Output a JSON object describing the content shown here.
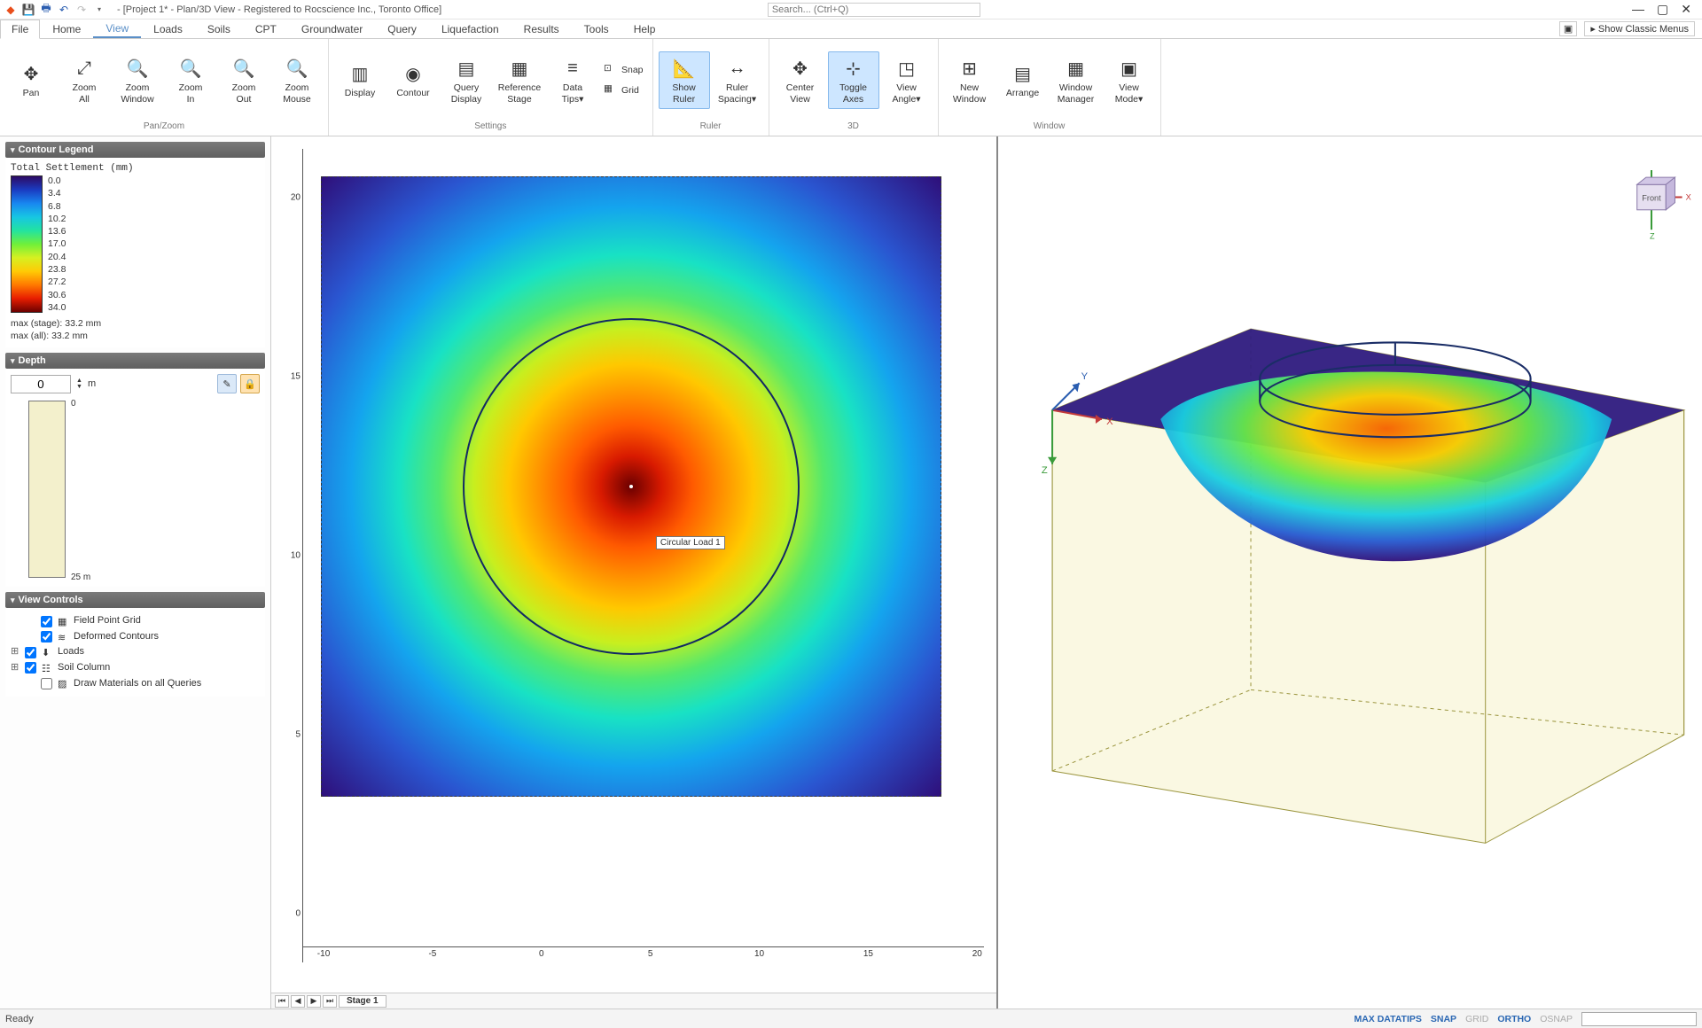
{
  "titlebar": {
    "title": "- [Project 1* - Plan/3D View - Registered to Rocscience Inc., Toronto Office]",
    "search_placeholder": "Search... (Ctrl+Q)"
  },
  "tabs": {
    "items": [
      "File",
      "Home",
      "View",
      "Loads",
      "Soils",
      "CPT",
      "Groundwater",
      "Query",
      "Liquefaction",
      "Results",
      "Tools",
      "Help"
    ],
    "active": "View",
    "classic_menus": "Show Classic Menus"
  },
  "ribbon": {
    "panzoom": {
      "label": "Pan/Zoom",
      "pan": "Pan",
      "zoom_all": "Zoom\nAll",
      "zoom_window": "Zoom\nWindow",
      "zoom_in": "Zoom\nIn",
      "zoom_out": "Zoom\nOut",
      "zoom_mouse": "Zoom\nMouse"
    },
    "settings": {
      "label": "Settings",
      "display": "Display",
      "contour": "Contour",
      "query_display": "Query\nDisplay",
      "reference_stage": "Reference\nStage",
      "data_tips": "Data\nTips▾",
      "snap": "Snap",
      "grid": "Grid"
    },
    "ruler": {
      "label": "Ruler",
      "show_ruler": "Show\nRuler",
      "ruler_spacing": "Ruler\nSpacing▾"
    },
    "threeD": {
      "label": "3D",
      "center_view": "Center\nView",
      "toggle_axes": "Toggle\nAxes",
      "view_angle": "View\nAngle▾"
    },
    "window": {
      "label": "Window",
      "new_window": "New\nWindow",
      "arrange": "Arrange",
      "window_manager": "Window\nManager",
      "view_mode": "View\nMode▾"
    }
  },
  "contour_legend": {
    "heading": "Contour Legend",
    "title": "Total Settlement (mm)",
    "values": [
      "0.0",
      "3.4",
      "6.8",
      "10.2",
      "13.6",
      "17.0",
      "20.4",
      "23.8",
      "27.2",
      "30.6",
      "34.0"
    ],
    "max_stage": "max (stage): 33.2 mm",
    "max_all": "max (all):   33.2 mm"
  },
  "depth": {
    "heading": "Depth",
    "value": "0",
    "unit": "m",
    "top_label": "0",
    "bottom_label": "25 m"
  },
  "view_controls": {
    "heading": "View Controls",
    "items": [
      {
        "label": "Field Point Grid",
        "checked": true,
        "expand": ""
      },
      {
        "label": "Deformed Contours",
        "checked": true,
        "expand": ""
      },
      {
        "label": "Loads",
        "checked": true,
        "expand": "⊞"
      },
      {
        "label": "Soil Column",
        "checked": true,
        "expand": "⊞"
      },
      {
        "label": "Draw Materials on all Queries",
        "checked": false,
        "expand": ""
      }
    ]
  },
  "plan_view": {
    "y_ticks": [
      "20",
      "15",
      "10",
      "5",
      "0"
    ],
    "x_ticks": [
      "-10",
      "-5",
      "0",
      "5",
      "10",
      "15",
      "20"
    ],
    "load_label": "Circular Load 1",
    "stage_tab": "Stage 1"
  },
  "axes3d": {
    "x": "X",
    "y": "Y",
    "z": "Z",
    "front": "Front"
  },
  "status": {
    "ready": "Ready",
    "toggles": [
      {
        "label": "MAX DATATIPS",
        "on": true
      },
      {
        "label": "SNAP",
        "on": true
      },
      {
        "label": "GRID",
        "on": false
      },
      {
        "label": "ORTHO",
        "on": true
      },
      {
        "label": "OSNAP",
        "on": false
      }
    ]
  },
  "chart_data": {
    "type": "heatmap",
    "title": "Total Settlement (mm)",
    "xlabel": "",
    "ylabel": "",
    "xlim": [
      -12,
      22
    ],
    "ylim": [
      -1,
      21
    ],
    "colorbar_range": [
      0.0,
      34.0
    ],
    "colorbar_ticks": [
      0.0,
      3.4,
      6.8,
      10.2,
      13.6,
      17.0,
      20.4,
      23.8,
      27.2,
      30.6,
      34.0
    ],
    "geometry": {
      "shape": "circular_load",
      "center": [
        5,
        5
      ],
      "radius": 5.5
    },
    "peak_value": 33.2,
    "annotations": [
      "Circular Load 1"
    ]
  }
}
